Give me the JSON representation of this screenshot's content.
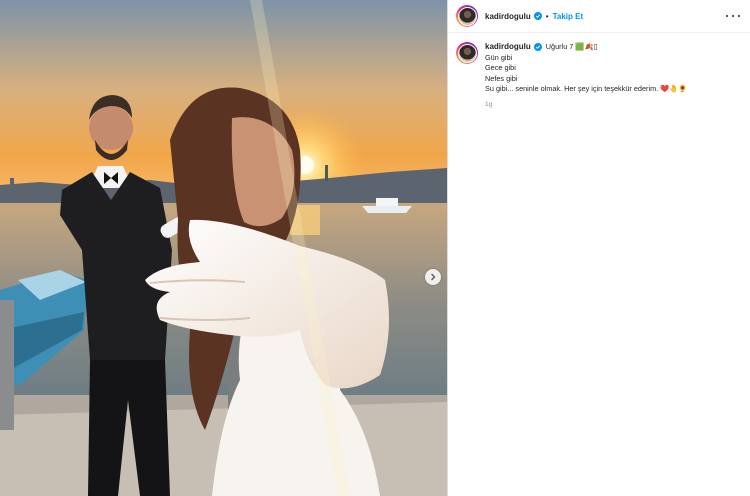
{
  "post": {
    "username": "kadirdogulu",
    "follow_label": "Takip Et",
    "separator": "•",
    "caption": {
      "first_line": "Uğurlu 7 🟩🍂▯",
      "lines": [
        "Gün gibi",
        "Gece gibi",
        "Nefes gibi",
        "Su gibi... seninle olmak. Her şey için teşekkür ederim. ❤️🤚🌻"
      ]
    },
    "time_ago": "1g"
  },
  "icons": {
    "verified": "verified-badge-icon",
    "more": "more-options-icon",
    "next": "chevron-right-icon"
  },
  "colors": {
    "accent": "#0095f6",
    "text": "#262626",
    "muted": "#8e8e8e",
    "border": "#dbdbdb"
  }
}
